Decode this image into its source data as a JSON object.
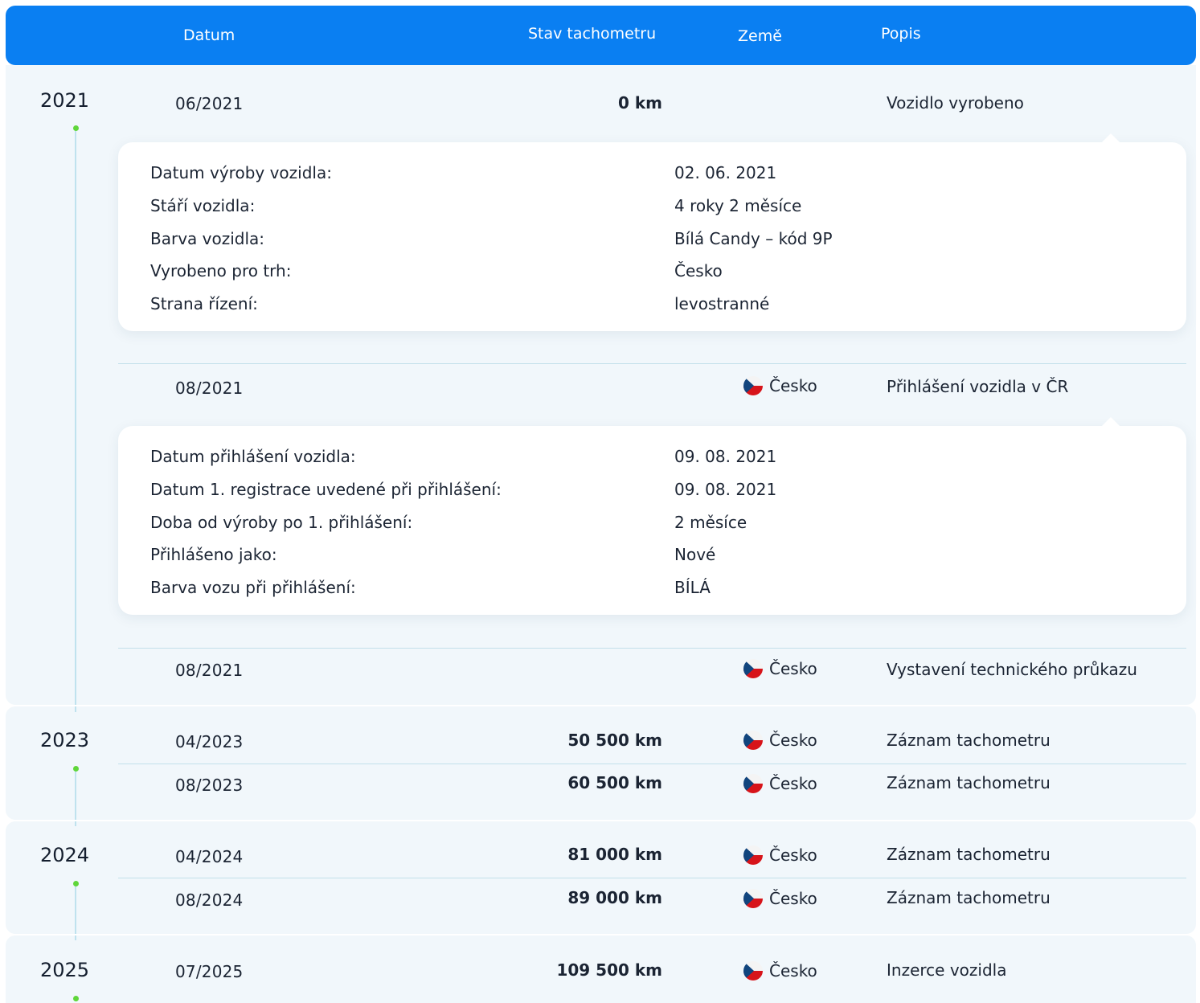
{
  "header": {
    "date": "Datum",
    "odometer": "Stav tachometru",
    "country": "Země",
    "description": "Popis"
  },
  "years": {
    "y2021": "2021",
    "y2023": "2023",
    "y2024": "2024",
    "y2025": "2025"
  },
  "rows": [
    {
      "date": "06/2021",
      "km": "0 km",
      "country": "",
      "desc": "Vozidlo vyrobeno"
    },
    {
      "date": "08/2021",
      "km": "",
      "country": "Česko",
      "desc": "Přihlášení vozidla v ČR"
    },
    {
      "date": "08/2021",
      "km": "",
      "country": "Česko",
      "desc": "Vystavení technického průkazu"
    },
    {
      "date": "04/2023",
      "km": "50 500 km",
      "country": "Česko",
      "desc": "Záznam tachometru"
    },
    {
      "date": "08/2023",
      "km": "60 500 km",
      "country": "Česko",
      "desc": "Záznam tachometru"
    },
    {
      "date": "04/2024",
      "km": "81 000 km",
      "country": "Česko",
      "desc": "Záznam tachometru"
    },
    {
      "date": "08/2024",
      "km": "89 000 km",
      "country": "Česko",
      "desc": "Záznam tachometru"
    },
    {
      "date": "07/2025",
      "km": "109 500 km",
      "country": "Česko",
      "desc": "Inzerce vozidla"
    }
  ],
  "production_card": [
    {
      "label": "Datum výroby vozidla:",
      "value": "02. 06. 2021"
    },
    {
      "label": "Stáří vozidla:",
      "value": "4 roky 2 měsíce"
    },
    {
      "label": "Barva vozidla:",
      "value": "Bílá Candy – kód 9P"
    },
    {
      "label": "Vyrobeno pro trh:",
      "value": "Česko"
    },
    {
      "label": "Strana řízení:",
      "value": "levostranné"
    }
  ],
  "registration_card": [
    {
      "label": "Datum přihlášení vozidla:",
      "value": "09. 08. 2021"
    },
    {
      "label": "Datum 1. registrace uvedené při přihlášení:",
      "value": "09. 08. 2021"
    },
    {
      "label": "Doba od výroby po 1. přihlášení:",
      "value": "2 měsíce"
    },
    {
      "label": "Přihlášeno jako:",
      "value": "Nové"
    },
    {
      "label": "Barva vozu při přihlášení:",
      "value": "BÍLÁ"
    }
  ],
  "icons": {
    "flag": "czech-flag-icon",
    "timeline_dot": "timeline-dot-icon"
  },
  "colors": {
    "header": "#0a7ff2",
    "section": "#f1f7fb",
    "dot": "#5fd63a",
    "line": "#bfe2ee"
  }
}
